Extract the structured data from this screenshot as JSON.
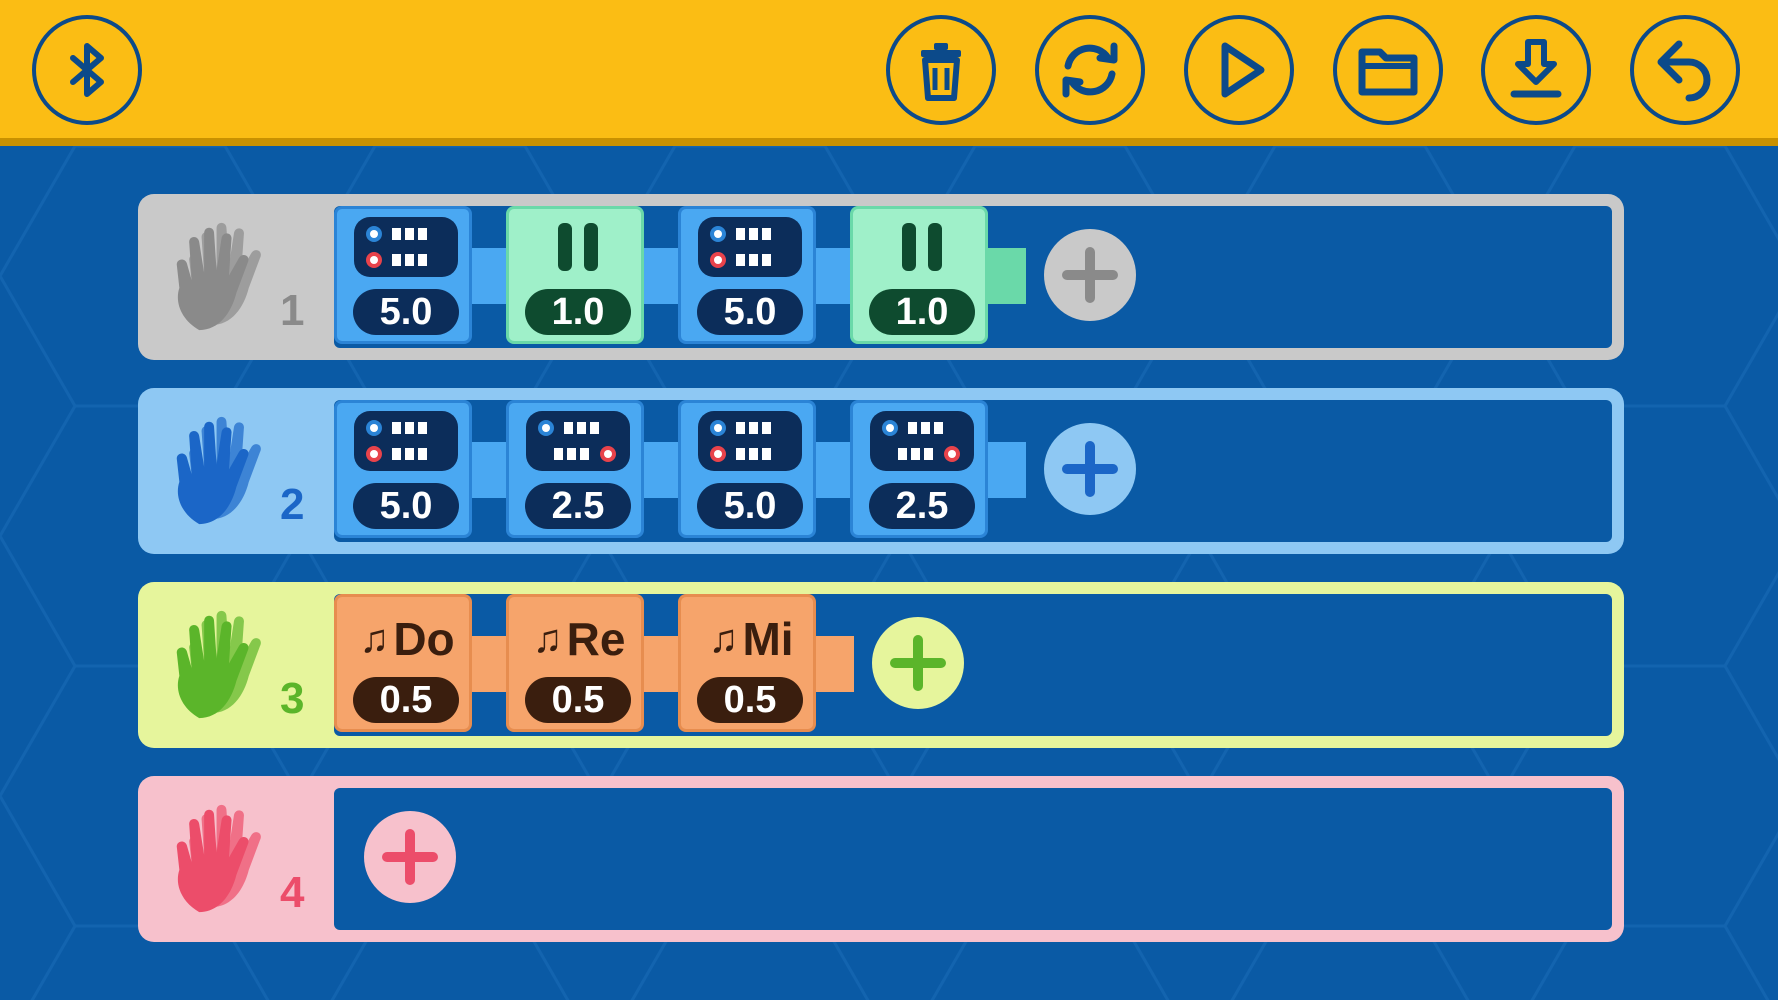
{
  "colors": {
    "topbar": "#fbbd14",
    "background": "#0a5aa5",
    "icon_stroke": "#0c4a8a",
    "row1": "#c9c9c9",
    "row2": "#8ec8f3",
    "row3": "#e6f59c",
    "row4": "#f7c1cc"
  },
  "toolbar": {
    "bluetooth": "bluetooth-icon",
    "delete": "trash-icon",
    "refresh": "refresh-icon",
    "play": "play-icon",
    "open": "folder-icon",
    "download": "download-icon",
    "undo": "undo-icon"
  },
  "rows": [
    {
      "number": "1",
      "color": "#c9c9c9",
      "blocks": [
        {
          "type": "motor",
          "value": "5.0"
        },
        {
          "type": "wait",
          "value": "1.0"
        },
        {
          "type": "motor",
          "value": "5.0"
        },
        {
          "type": "wait",
          "value": "1.0"
        }
      ]
    },
    {
      "number": "2",
      "color": "#8ec8f3",
      "blocks": [
        {
          "type": "motor",
          "value": "5.0"
        },
        {
          "type": "motor",
          "value": "2.5"
        },
        {
          "type": "motor",
          "value": "5.0"
        },
        {
          "type": "motor",
          "value": "2.5"
        }
      ]
    },
    {
      "number": "3",
      "color": "#e6f59c",
      "blocks": [
        {
          "type": "note",
          "note": "Do",
          "value": "0.5"
        },
        {
          "type": "note",
          "note": "Re",
          "value": "0.5"
        },
        {
          "type": "note",
          "note": "Mi",
          "value": "0.5"
        }
      ]
    },
    {
      "number": "4",
      "color": "#f7c1cc",
      "blocks": []
    }
  ]
}
